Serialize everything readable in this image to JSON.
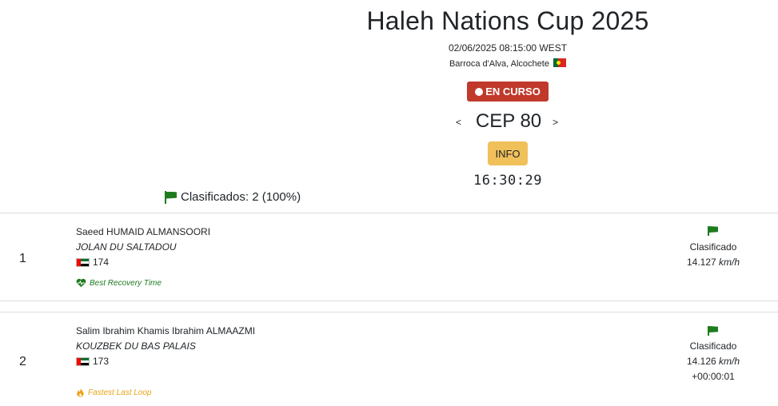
{
  "event": {
    "title": "Haleh Nations Cup 2025",
    "datetime": "02/06/2025 08:15:00 WEST",
    "location": "Barroca d'Alva, Alcochete",
    "country_flag": "flag-portugal"
  },
  "status": {
    "label": "EN CURSO",
    "color": "#c0392b"
  },
  "checkpoint": {
    "prev": "<",
    "label": "CEP 80",
    "next": ">"
  },
  "info_button": "INFO",
  "clock": "16:30:29",
  "summary": {
    "text": "Clasificados: 2 (100%)"
  },
  "results": [
    {
      "rank": "1",
      "rider": "Saeed HUMAID ALMANSOORI",
      "horse": "JOLAN DU SALTADOU",
      "nation_flag": "flag-uae",
      "number": "174",
      "award": "Best Recovery Time",
      "award_icon": "heart-pulse-icon",
      "status": "Clasificado",
      "speed": "14.127",
      "speed_unit": "km/h",
      "gap": ""
    },
    {
      "rank": "2",
      "rider": "Salim Ibrahim Khamis Ibrahim ALMAAZMI",
      "horse": "KOUZBEK DU BAS PALAIS",
      "nation_flag": "flag-uae",
      "number": "173",
      "award": "Fastest Last Loop",
      "award_icon": "fire-icon",
      "status": "Clasificado",
      "speed": "14.126",
      "speed_unit": "km/h",
      "gap": "+00:00:01"
    }
  ],
  "colors": {
    "accent_green": "#1e7b1e",
    "accent_orange": "#e8a317",
    "info_yellow": "#f0c05a"
  }
}
